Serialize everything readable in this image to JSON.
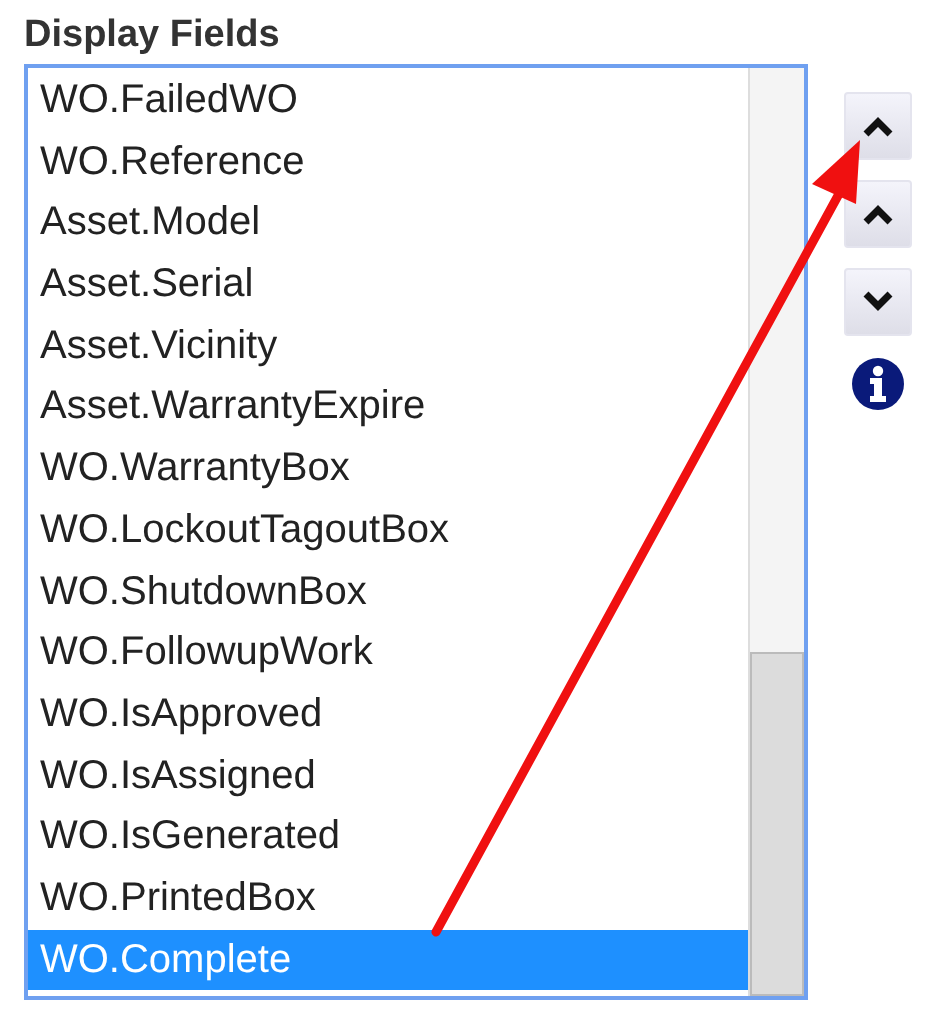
{
  "label": "Display Fields",
  "fields": [
    {
      "text": "WO.FailedWO",
      "selected": false
    },
    {
      "text": "WO.Reference",
      "selected": false
    },
    {
      "text": "Asset.Model",
      "selected": false
    },
    {
      "text": "Asset.Serial",
      "selected": false
    },
    {
      "text": "Asset.Vicinity",
      "selected": false
    },
    {
      "text": "Asset.WarrantyExpire",
      "selected": false
    },
    {
      "text": "WO.WarrantyBox",
      "selected": false
    },
    {
      "text": "WO.LockoutTagoutBox",
      "selected": false
    },
    {
      "text": "WO.ShutdownBox",
      "selected": false
    },
    {
      "text": "WO.FollowupWork",
      "selected": false
    },
    {
      "text": "WO.IsApproved",
      "selected": false
    },
    {
      "text": "WO.IsAssigned",
      "selected": false
    },
    {
      "text": "WO.IsGenerated",
      "selected": false
    },
    {
      "text": "WO.PrintedBox",
      "selected": false
    },
    {
      "text": "WO.Complete",
      "selected": true
    }
  ],
  "buttons": [
    {
      "kind": "top"
    },
    {
      "kind": "up"
    },
    {
      "kind": "down"
    },
    {
      "kind": "info"
    }
  ]
}
